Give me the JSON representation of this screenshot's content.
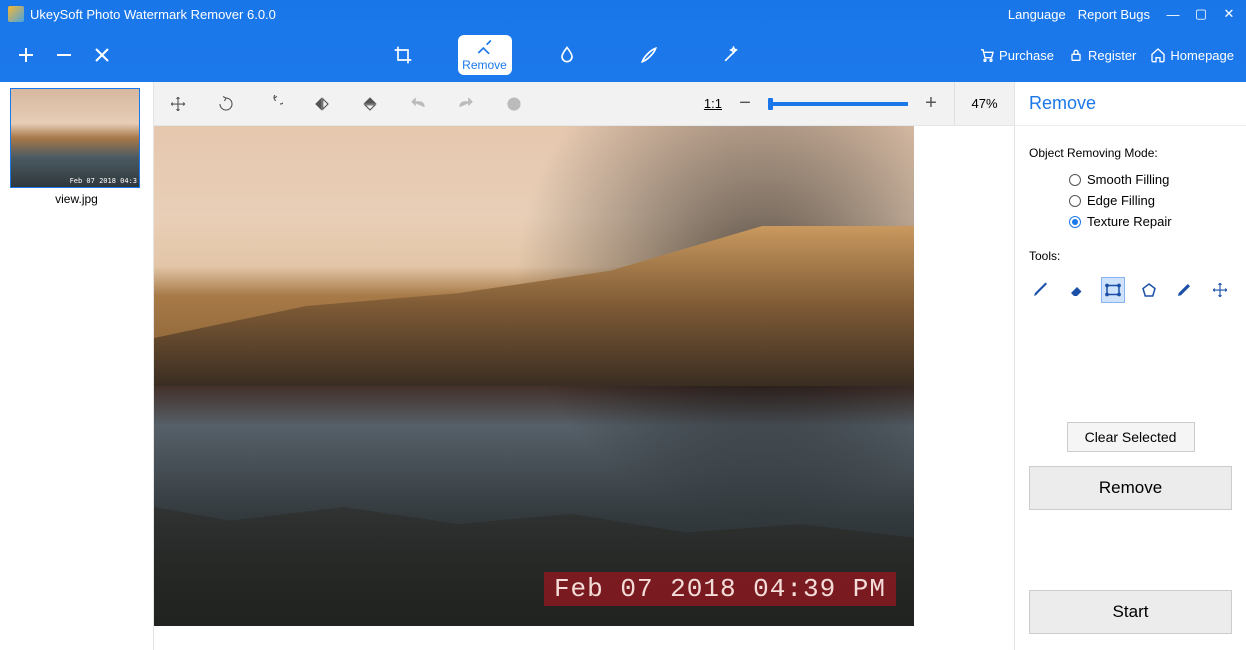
{
  "titlebar": {
    "title": "UkeySoft Photo Watermark Remover 6.0.0",
    "language": "Language",
    "report_bugs": "Report Bugs"
  },
  "topbar": {
    "remove_label": "Remove",
    "purchase": "Purchase",
    "register": "Register",
    "homepage": "Homepage"
  },
  "thumb": {
    "filename": "view.jpg",
    "stamp": "Feb 07 2018 04:3"
  },
  "edit": {
    "ratio": "1:1",
    "zoom_pct": "47%"
  },
  "canvas": {
    "watermark": "Feb 07 2018 04:39 PM"
  },
  "panel": {
    "title": "Remove",
    "mode_label": "Object Removing Mode:",
    "modes": {
      "smooth": "Smooth Filling",
      "edge": "Edge Filling",
      "texture": "Texture Repair"
    },
    "tools_label": "Tools:",
    "clear": "Clear Selected",
    "remove": "Remove",
    "start": "Start"
  }
}
